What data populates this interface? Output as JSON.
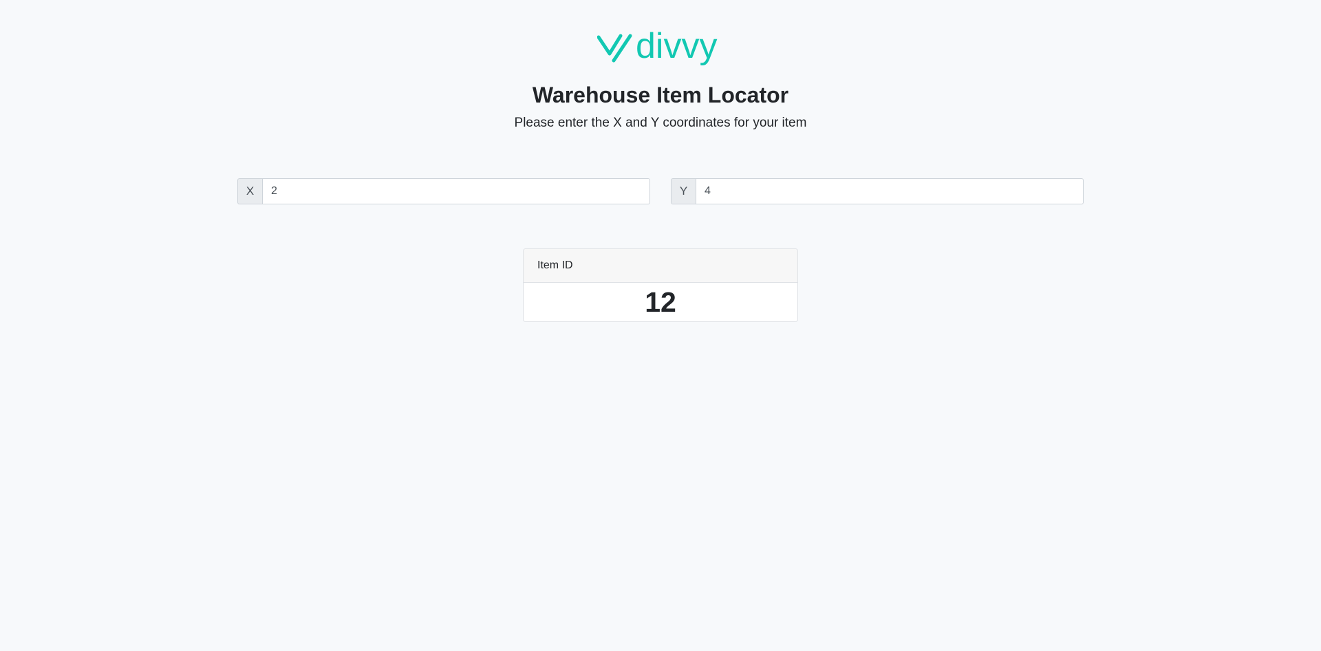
{
  "brand": {
    "logo_text": "divvy",
    "color": "#12c8b2"
  },
  "page": {
    "title": "Warehouse Item Locator",
    "subtitle": "Please enter the X and Y coordinates for your item"
  },
  "inputs": {
    "x": {
      "label": "X",
      "value": "2"
    },
    "y": {
      "label": "Y",
      "value": "4"
    }
  },
  "result": {
    "header": "Item ID",
    "value": "12"
  }
}
